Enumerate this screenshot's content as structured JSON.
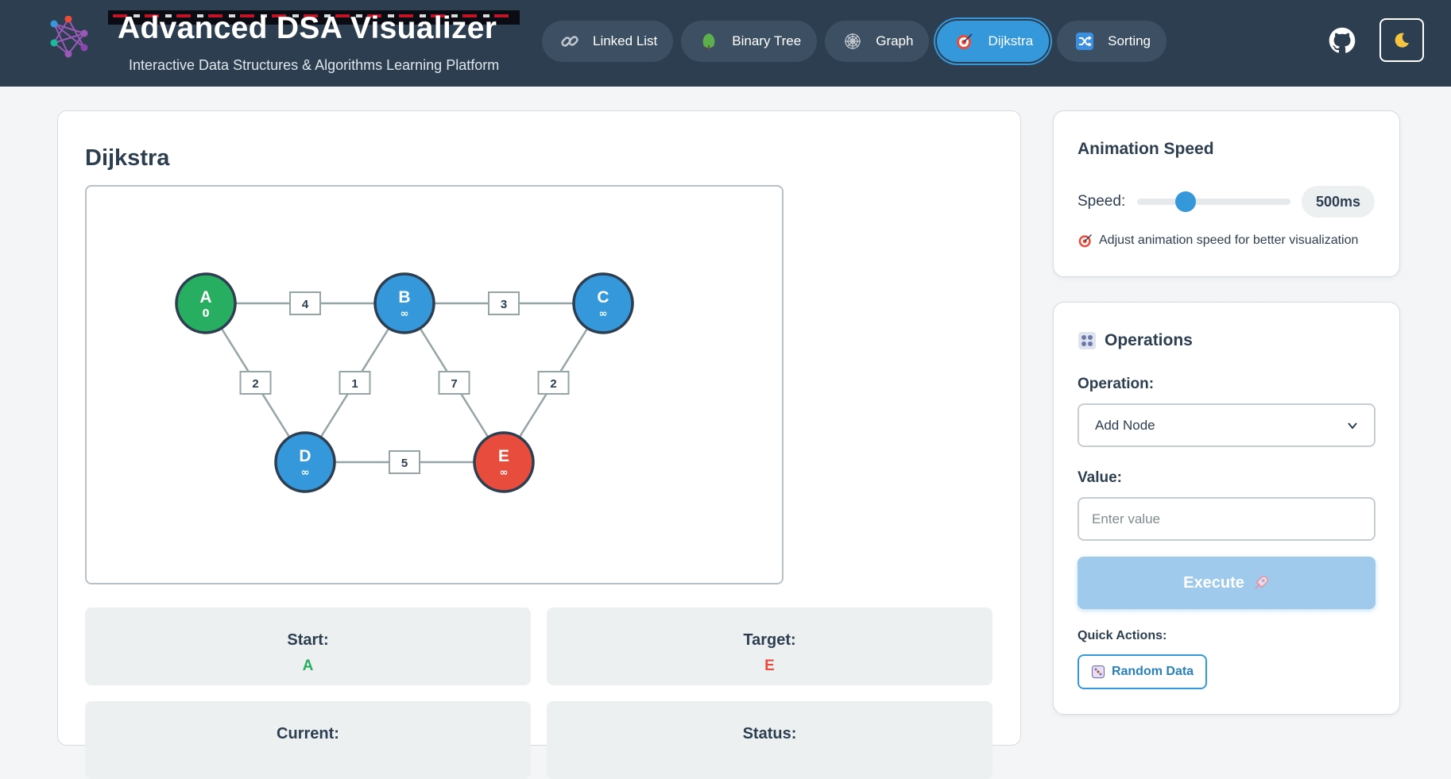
{
  "app": {
    "title": "Advanced DSA Visualizer",
    "subtitle": "Interactive Data Structures & Algorithms Learning Platform"
  },
  "nav": [
    {
      "label": "Linked List",
      "icon": "link-icon",
      "active": false
    },
    {
      "label": "Binary Tree",
      "icon": "tree-icon",
      "active": false
    },
    {
      "label": "Graph",
      "icon": "web-icon",
      "active": false
    },
    {
      "label": "Dijkstra",
      "icon": "target-icon",
      "active": true
    },
    {
      "label": "Sorting",
      "icon": "shuffle-icon",
      "active": false
    }
  ],
  "header_actions": {
    "github": "github-icon",
    "theme": "moon-icon"
  },
  "main": {
    "title": "Dijkstra",
    "graph": {
      "nodes": [
        {
          "id": "A",
          "dist": "0",
          "state": "start",
          "color": "#27ae60"
        },
        {
          "id": "B",
          "dist": "∞",
          "state": "unvisited",
          "color": "#3498db"
        },
        {
          "id": "C",
          "dist": "∞",
          "state": "unvisited",
          "color": "#3498db"
        },
        {
          "id": "D",
          "dist": "∞",
          "state": "unvisited",
          "color": "#3498db"
        },
        {
          "id": "E",
          "dist": "∞",
          "state": "target",
          "color": "#e74c3c"
        }
      ],
      "edges": [
        {
          "from": "A",
          "to": "B",
          "weight": "4"
        },
        {
          "from": "B",
          "to": "C",
          "weight": "3"
        },
        {
          "from": "A",
          "to": "D",
          "weight": "2"
        },
        {
          "from": "B",
          "to": "D",
          "weight": "1"
        },
        {
          "from": "B",
          "to": "E",
          "weight": "7"
        },
        {
          "from": "C",
          "to": "E",
          "weight": "2"
        },
        {
          "from": "D",
          "to": "E",
          "weight": "5"
        }
      ]
    },
    "info": {
      "start_label": "Start:",
      "start_value": "A",
      "target_label": "Target:",
      "target_value": "E",
      "current_label": "Current:",
      "status_label": "Status:"
    }
  },
  "speed_card": {
    "title": "Animation Speed",
    "label": "Speed:",
    "value": "500ms",
    "slider_fraction": 0.25,
    "hint": "Adjust animation speed for better visualization"
  },
  "ops_card": {
    "title": "Operations",
    "operation_label": "Operation:",
    "operation_selected": "Add Node",
    "value_label": "Value:",
    "value_placeholder": "Enter value",
    "execute_label": "Execute",
    "quick_actions_label": "Quick Actions:",
    "random_label": "Random Data"
  },
  "colors": {
    "header_bg": "#2c3e50",
    "accent": "#3498db",
    "start": "#27ae60",
    "target": "#e74c3c"
  }
}
